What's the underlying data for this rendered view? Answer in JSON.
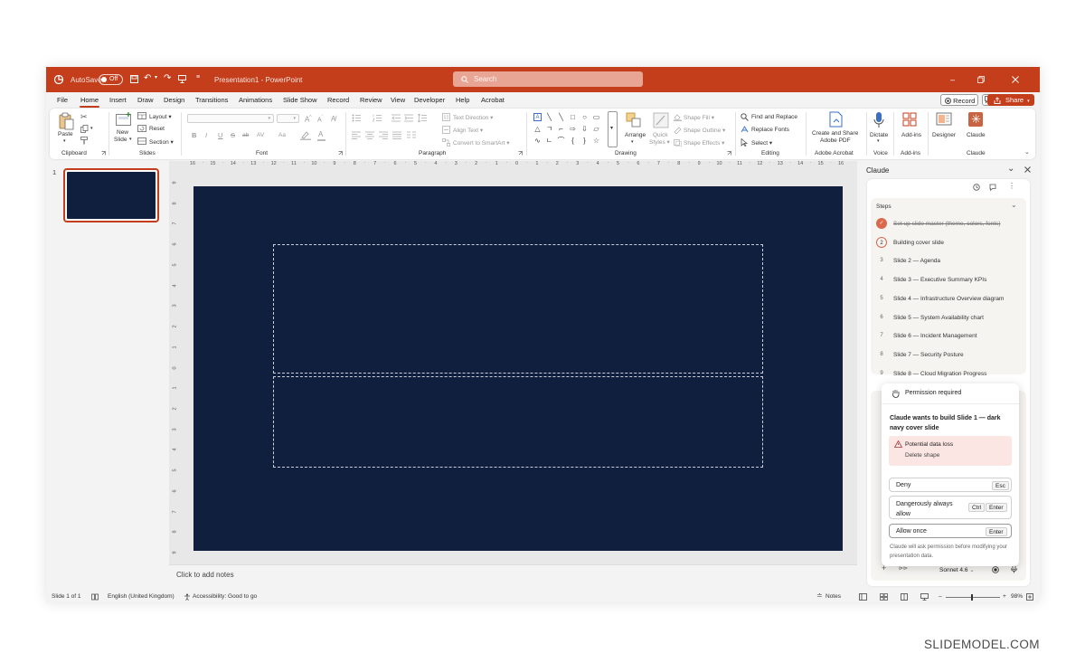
{
  "titlebar": {
    "autosave_label": "AutoSave",
    "autosave_state": "Off",
    "doc_title": "Presentation1 - PowerPoint",
    "search_placeholder": "Search"
  },
  "menubar": {
    "tabs": [
      "File",
      "Home",
      "Insert",
      "Draw",
      "Design",
      "Transitions",
      "Animations",
      "Slide Show",
      "Record",
      "Review",
      "View",
      "Developer",
      "Help",
      "Acrobat"
    ],
    "active_tab": "Home",
    "record_label": "Record",
    "share_label": "Share"
  },
  "ribbon": {
    "clipboard": {
      "paste": "Paste",
      "group": "Clipboard"
    },
    "slides": {
      "new_slide": "New",
      "new_slide2": "Slide",
      "layout": "Layout",
      "reset": "Reset",
      "section": "Section",
      "group": "Slides"
    },
    "font": {
      "group": "Font",
      "buttons": [
        "B",
        "I",
        "U",
        "S",
        "ab",
        "AV",
        "Aa",
        "A"
      ]
    },
    "paragraph": {
      "group": "Paragraph",
      "text_direction": "Text Direction",
      "align_text": "Align Text",
      "convert_smartart": "Convert to SmartArt"
    },
    "drawing": {
      "group": "Drawing",
      "arrange": "Arrange",
      "quick_styles": "Quick",
      "quick_styles2": "Styles",
      "shape_fill": "Shape Fill",
      "shape_outline": "Shape Outline",
      "shape_effects": "Shape Effects"
    },
    "editing": {
      "group": "Editing",
      "find_replace": "Find and Replace",
      "replace_fonts": "Replace Fonts",
      "select": "Select"
    },
    "acrobat": {
      "group": "Adobe Acrobat",
      "label1": "Create and Share",
      "label2": "Adobe PDF"
    },
    "voice": {
      "group": "Voice",
      "dictate": "Dictate"
    },
    "addins": {
      "group": "Add-ins",
      "addins": "Add-ins"
    },
    "designer": {
      "label": "Designer"
    },
    "claude": {
      "group": "Claude",
      "label": "Claude"
    }
  },
  "rulers": {
    "horizontal": [
      "16",
      "15",
      "14",
      "13",
      "12",
      "11",
      "10",
      "9",
      "8",
      "7",
      "6",
      "5",
      "4",
      "3",
      "2",
      "1",
      "0",
      "1",
      "2",
      "3",
      "4",
      "5",
      "6",
      "7",
      "8",
      "9",
      "10",
      "11",
      "12",
      "13",
      "14",
      "15",
      "16"
    ],
    "vertical": [
      "9",
      "8",
      "7",
      "6",
      "5",
      "4",
      "3",
      "2",
      "1",
      "0",
      "1",
      "2",
      "3",
      "4",
      "5",
      "6",
      "7",
      "8",
      "9"
    ]
  },
  "thumbnails": {
    "number": "1"
  },
  "notes": {
    "placeholder": "Click to add notes"
  },
  "statusbar": {
    "slide": "Slide 1 of 1",
    "language": "English (United Kingdom)",
    "accessibility": "Accessibility: Good to go",
    "notes": "Notes",
    "zoom": "98%"
  },
  "claude_pane": {
    "title": "Claude",
    "steps_label": "Steps",
    "steps": [
      {
        "num": "✓",
        "label": "Set up slide master (theme, colors, fonts)",
        "state": "done"
      },
      {
        "num": "2",
        "label": "Building cover slide",
        "state": "active"
      },
      {
        "num": "3",
        "label": "Slide 2 — Agenda",
        "state": "pending"
      },
      {
        "num": "4",
        "label": "Slide 3 — Executive Summary KPIs",
        "state": "pending"
      },
      {
        "num": "5",
        "label": "Slide 4 — Infrastructure Overview diagram",
        "state": "pending"
      },
      {
        "num": "6",
        "label": "Slide 5 — System Availability chart",
        "state": "pending"
      },
      {
        "num": "7",
        "label": "Slide 6 — Incident Management",
        "state": "pending"
      },
      {
        "num": "8",
        "label": "Slide 7 — Security Posture",
        "state": "pending"
      },
      {
        "num": "9",
        "label": "Slide 8 — Cloud Migration Progress",
        "state": "pending"
      }
    ],
    "permission": {
      "header": "Permission required",
      "message": "Claude wants to build Slide 1 — dark navy cover slide",
      "warning_title": "Potential data loss",
      "warning_detail": "Delete shape",
      "deny": "Deny",
      "deny_key": "Esc",
      "always_allow": "Dangerously always allow",
      "always_key1": "Ctrl",
      "always_key2": "Enter",
      "allow_once": "Allow once",
      "allow_key": "Enter",
      "footnote": "Claude will ask permission before modifying your presentation data."
    },
    "model": "Sonnet 4.6"
  },
  "colors": {
    "accent": "#c43e1c",
    "slide_bg": "#0f1f3d"
  },
  "watermark": "SLIDEMODEL.COM"
}
